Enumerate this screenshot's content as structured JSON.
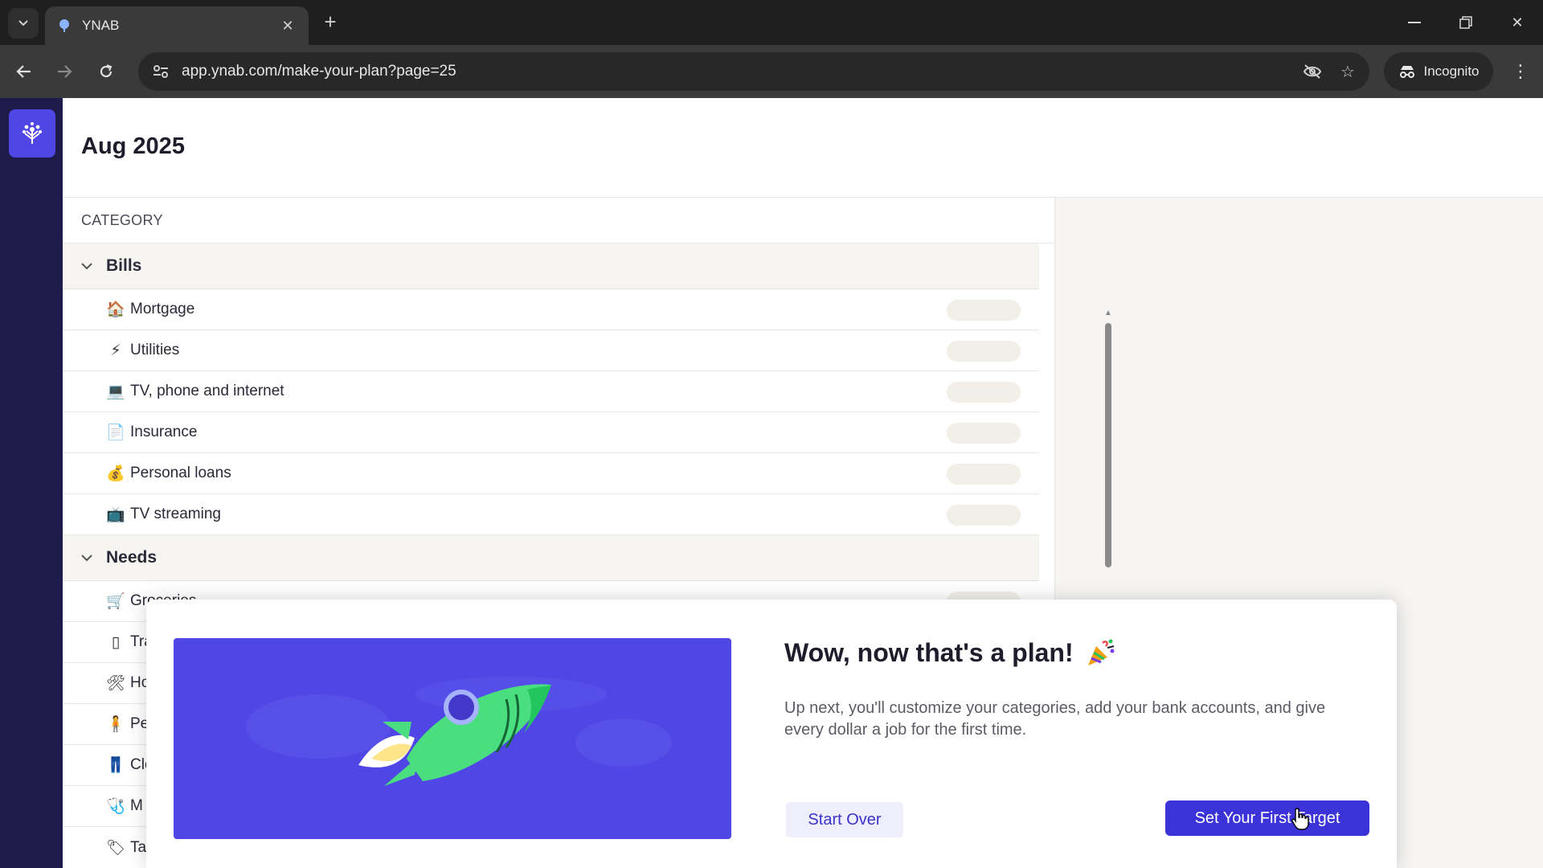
{
  "browser": {
    "tab_title": "YNAB",
    "url": "app.ynab.com/make-your-plan?page=25",
    "incognito_label": "Incognito",
    "icons": [
      "tab-dropdown-icon",
      "ynab-favicon",
      "close-icon",
      "plus-icon",
      "minimize-icon",
      "restore-icon",
      "window-close-icon",
      "back-icon",
      "forward-icon",
      "reload-icon",
      "site-settings-icon",
      "eye-off-icon",
      "star-icon",
      "incognito-icon",
      "kebab-menu-icon"
    ]
  },
  "app": {
    "month": "Aug 2025",
    "column_header": "CATEGORY",
    "groups": [
      {
        "name": "Bills",
        "items": [
          {
            "emoji": "🏠",
            "label": "Mortgage"
          },
          {
            "emoji": "⚡",
            "label": "Utilities"
          },
          {
            "emoji": "💻",
            "label": "TV, phone and internet"
          },
          {
            "emoji": "📄",
            "label": "Insurance"
          },
          {
            "emoji": "💰",
            "label": "Personal loans"
          },
          {
            "emoji": "📺",
            "label": "TV streaming"
          }
        ]
      },
      {
        "name": "Needs",
        "items": [
          {
            "emoji": "🛒",
            "label": "Groceries"
          },
          {
            "emoji": "▯",
            "label": "Trai"
          },
          {
            "emoji": "🛠",
            "label": "Ho"
          },
          {
            "emoji": "🧍",
            "label": "Pe"
          },
          {
            "emoji": "👖",
            "label": "Clo"
          },
          {
            "emoji": "🩺",
            "label": "M"
          },
          {
            "emoji": "🏷",
            "label": "Ta"
          }
        ]
      }
    ]
  },
  "modal": {
    "title": "Wow, now that's a plan!",
    "body": "Up next, you'll customize your categories, add your bank accounts, and give every dollar a job for the first time.",
    "start_over_label": "Start Over",
    "primary_label": "Set Your First Target"
  },
  "colors": {
    "brand": "#4f46e5",
    "sidebar": "#1e1b4b",
    "primary_button": "#3b32d8",
    "rocket": "#4ade80"
  }
}
